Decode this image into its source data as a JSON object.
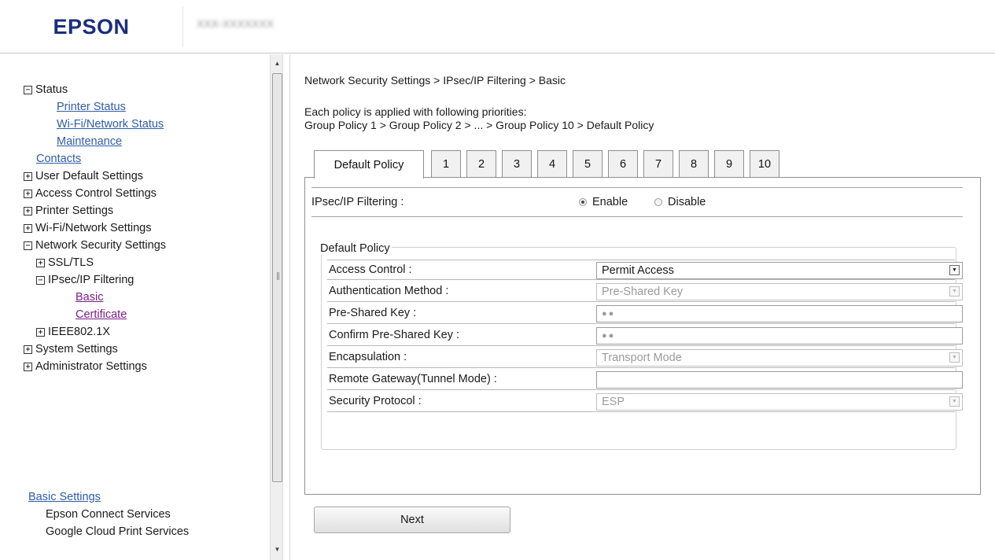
{
  "header": {
    "logo": "EPSON",
    "model_name": "XXX-XXXXXXX"
  },
  "sidebar": {
    "tree": [
      {
        "label": "Status",
        "expander": "−",
        "level": 0,
        "link": false
      },
      {
        "label": "Printer Status",
        "level": 2,
        "link": true
      },
      {
        "label": "Wi-Fi/Network Status",
        "level": 2,
        "link": true
      },
      {
        "label": "Maintenance",
        "level": 2,
        "link": true
      },
      {
        "label": "Contacts",
        "level": 1,
        "link": true
      },
      {
        "label": "User Default Settings",
        "expander": "+",
        "level": 0,
        "link": false
      },
      {
        "label": "Access Control Settings",
        "expander": "+",
        "level": 0,
        "link": false
      },
      {
        "label": "Printer Settings",
        "expander": "+",
        "level": 0,
        "link": false
      },
      {
        "label": "Wi-Fi/Network Settings",
        "expander": "+",
        "level": 0,
        "link": false
      },
      {
        "label": "Network Security Settings",
        "expander": "−",
        "level": 0,
        "link": false
      },
      {
        "label": "SSL/TLS",
        "expander": "+",
        "level": 1,
        "link": false
      },
      {
        "label": "IPsec/IP Filtering",
        "expander": "−",
        "level": 1,
        "link": false
      },
      {
        "label": "Basic",
        "level": 3,
        "link": true,
        "visited": true
      },
      {
        "label": "Certificate",
        "level": 3,
        "link": true,
        "visited": true
      },
      {
        "label": "IEEE802.1X",
        "expander": "+",
        "level": 1,
        "link": false
      },
      {
        "label": "System Settings",
        "expander": "+",
        "level": 0,
        "link": false
      },
      {
        "label": "Administrator Settings",
        "expander": "+",
        "level": 0,
        "link": false
      }
    ],
    "basic_settings": {
      "title": "Basic Settings",
      "items": [
        "Epson Connect Services",
        "Google Cloud Print Services"
      ]
    },
    "scrollbar_icons": {
      "up": "up-arrow-icon",
      "down": "down-arrow-icon"
    }
  },
  "main": {
    "breadcrumb": "Network Security Settings > IPsec/IP Filtering > Basic",
    "priority_intro": "Each policy is applied with following priorities:",
    "priority_order": "Group Policy 1 > Group Policy 2 > ... > Group Policy 10 > Default Policy",
    "tabs": [
      "Default Policy",
      "1",
      "2",
      "3",
      "4",
      "5",
      "6",
      "7",
      "8",
      "9",
      "10"
    ],
    "active_tab": "Default Policy",
    "filtering": {
      "label": "IPsec/IP Filtering :",
      "options": [
        "Enable",
        "Disable"
      ],
      "selected": "Enable"
    },
    "policy_section": {
      "legend": "Default Policy",
      "fields": [
        {
          "label": "Access Control :",
          "value": "Permit Access",
          "type": "select",
          "disabled": false
        },
        {
          "label": "Authentication Method :",
          "value": "Pre-Shared Key",
          "type": "select",
          "disabled": true
        },
        {
          "label": "Pre-Shared Key :",
          "value": "●●",
          "type": "password",
          "disabled": false
        },
        {
          "label": "Confirm Pre-Shared Key :",
          "value": "●●",
          "type": "password",
          "disabled": false
        },
        {
          "label": "Encapsulation :",
          "value": "Transport Mode",
          "type": "select",
          "disabled": true
        },
        {
          "label": "Remote Gateway(Tunnel Mode) :",
          "value": "",
          "type": "text",
          "disabled": false
        },
        {
          "label": "Security Protocol :",
          "value": "ESP",
          "type": "select",
          "disabled": true
        }
      ]
    },
    "next_button": "Next"
  },
  "colors": {
    "logo": "#1b2d7f",
    "link": "#2f5cab",
    "link_visited": "#7c1d89"
  }
}
